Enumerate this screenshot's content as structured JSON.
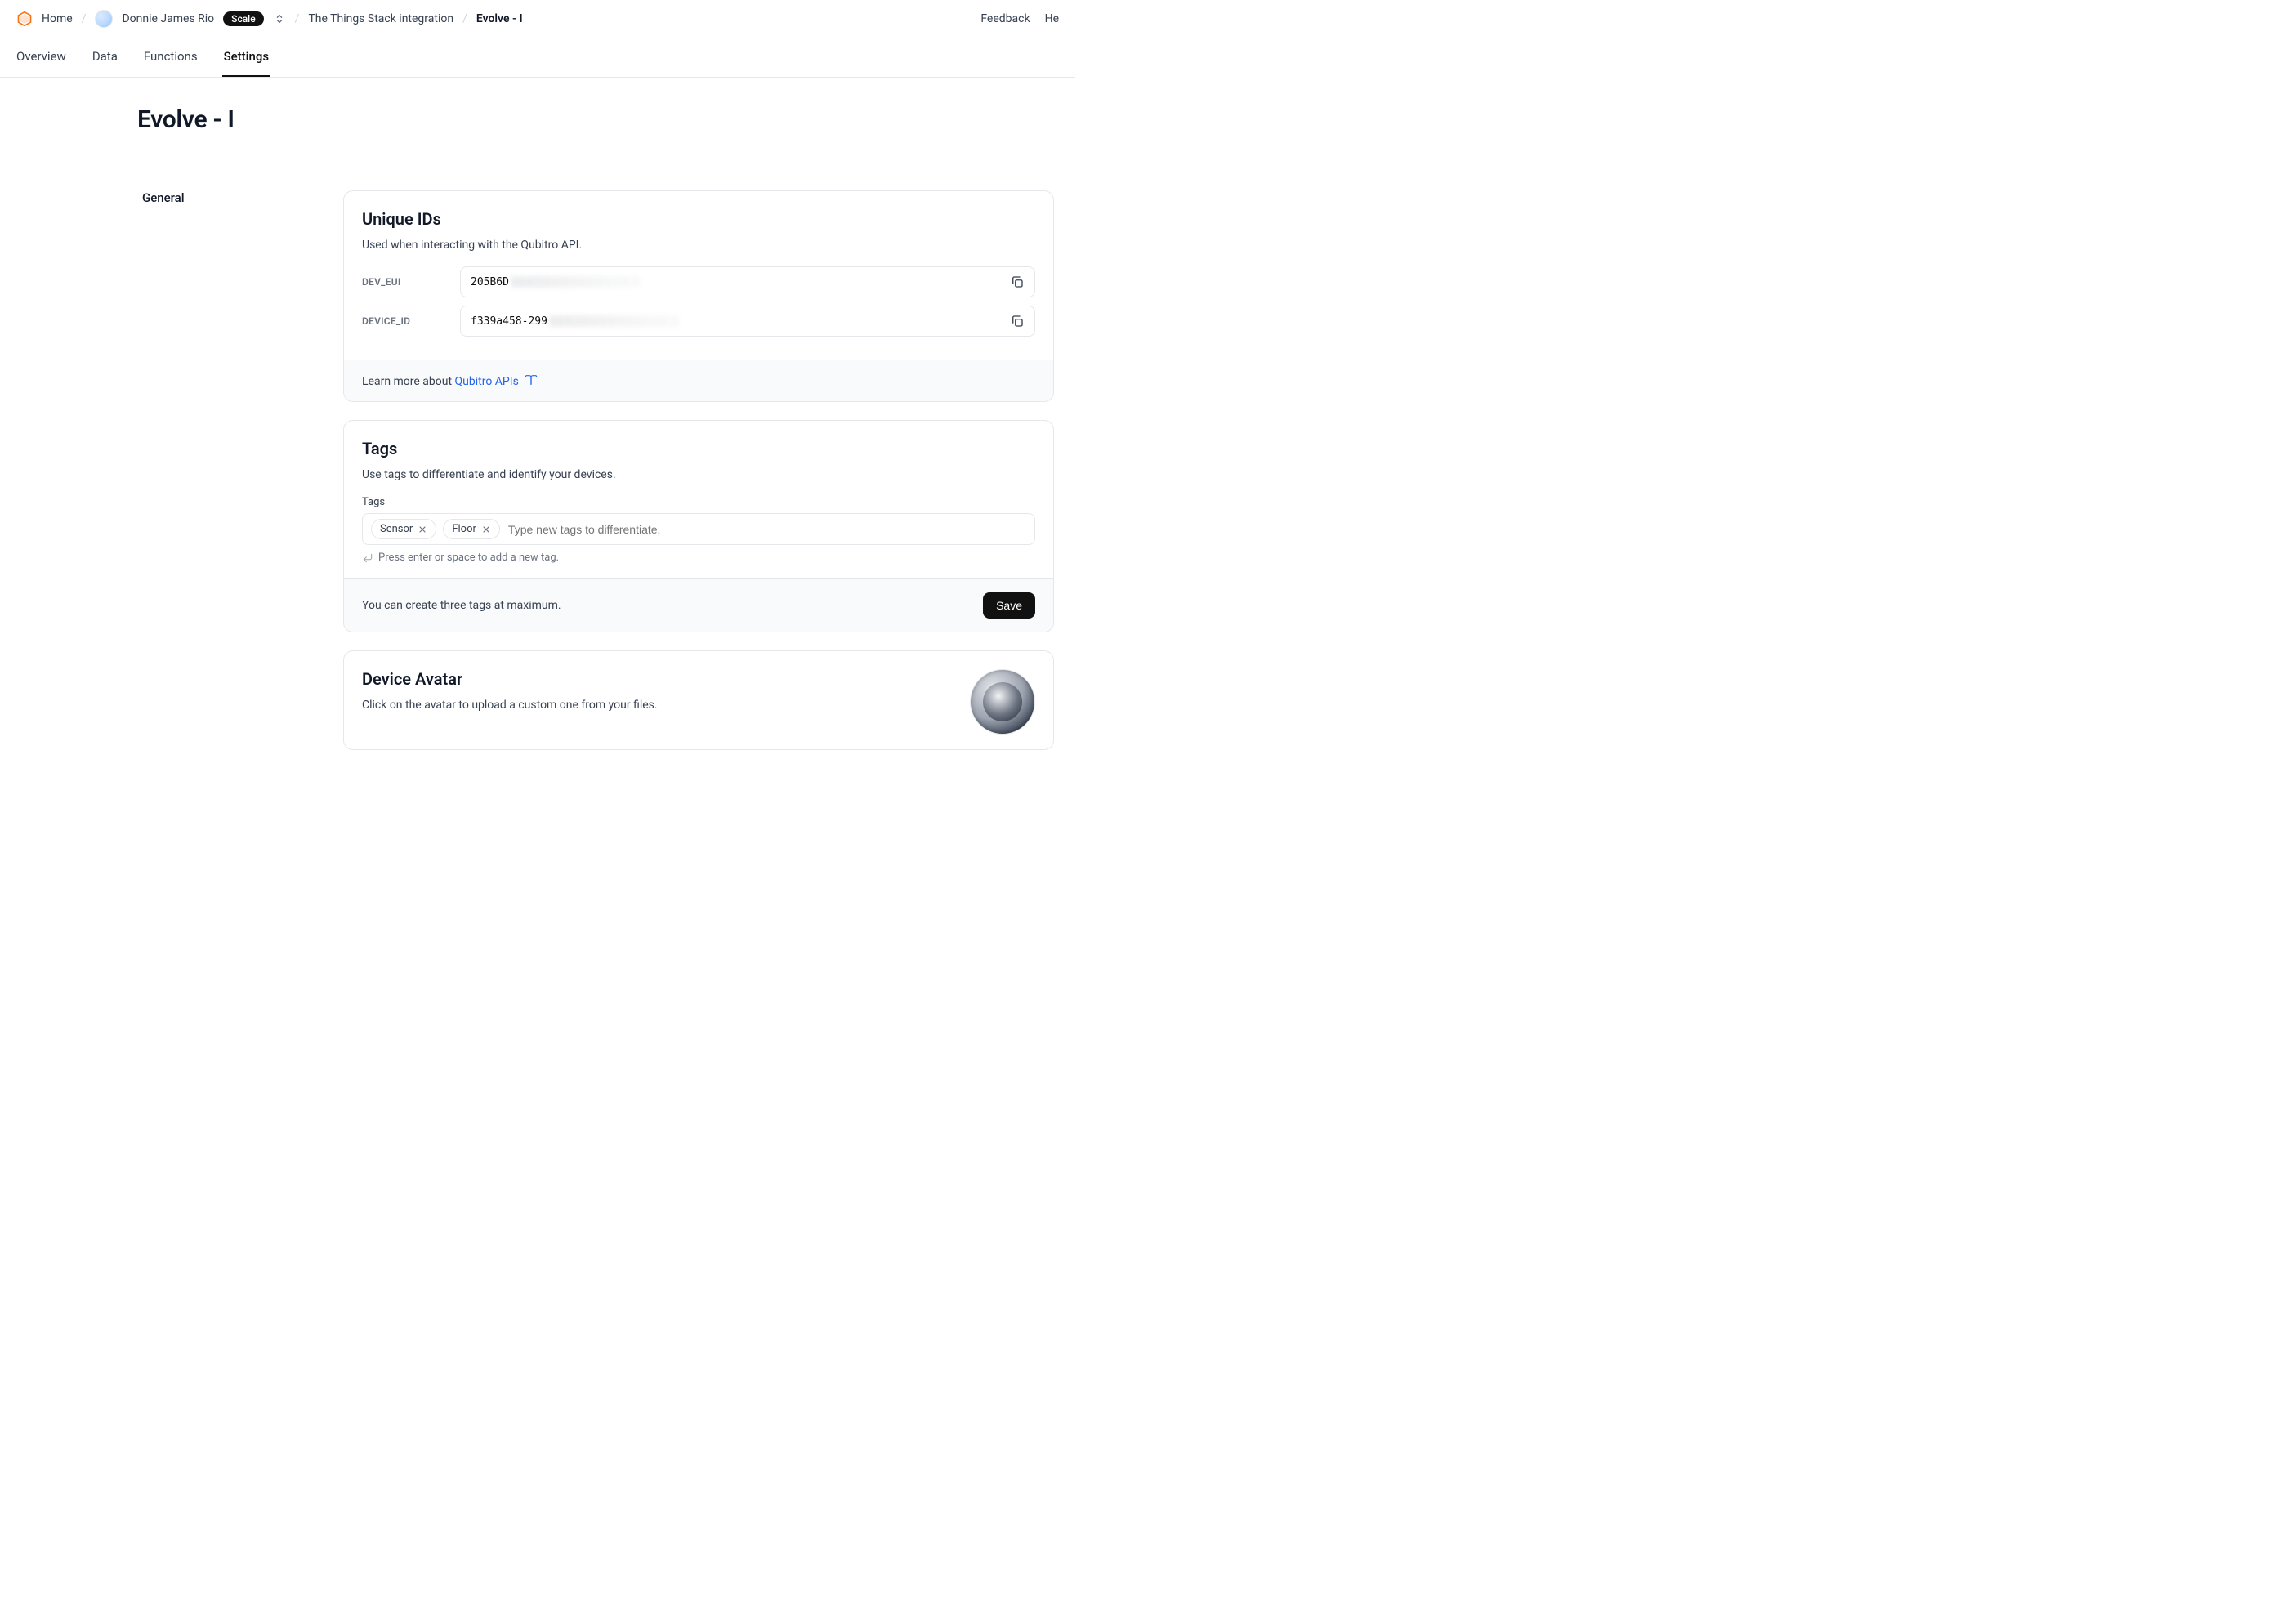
{
  "breadcrumbs": {
    "home": "Home",
    "user": "Donnie James  Rio",
    "plan_badge": "Scale",
    "project": "The Things Stack integration",
    "device": "Evolve - I"
  },
  "top_right": {
    "feedback": "Feedback",
    "help_partial": "He"
  },
  "tabs": [
    {
      "label": "Overview",
      "active": false
    },
    {
      "label": "Data",
      "active": false
    },
    {
      "label": "Functions",
      "active": false
    },
    {
      "label": "Settings",
      "active": true
    }
  ],
  "page_title": "Evolve - I",
  "sidebar": {
    "general": "General"
  },
  "unique_ids": {
    "title": "Unique IDs",
    "desc": "Used when interacting with the Qubitro API.",
    "fields": [
      {
        "label": "DEV_EUI",
        "value": "205B6D"
      },
      {
        "label": "DEVICE_ID",
        "value": "f339a458-299"
      }
    ],
    "learn_prefix": "Learn more about ",
    "learn_link": "Qubitro APIs"
  },
  "tags": {
    "title": "Tags",
    "desc": "Use tags to differentiate and identify your devices.",
    "label": "Tags",
    "items": [
      "Sensor",
      "Floor"
    ],
    "placeholder": "Type new tags to differentiate.",
    "hint": "Press enter or space to add a new tag.",
    "footer_text": "You can create three tags at maximum.",
    "save_label": "Save"
  },
  "avatar": {
    "title": "Device Avatar",
    "desc": "Click on the avatar to upload a custom one from your files."
  }
}
